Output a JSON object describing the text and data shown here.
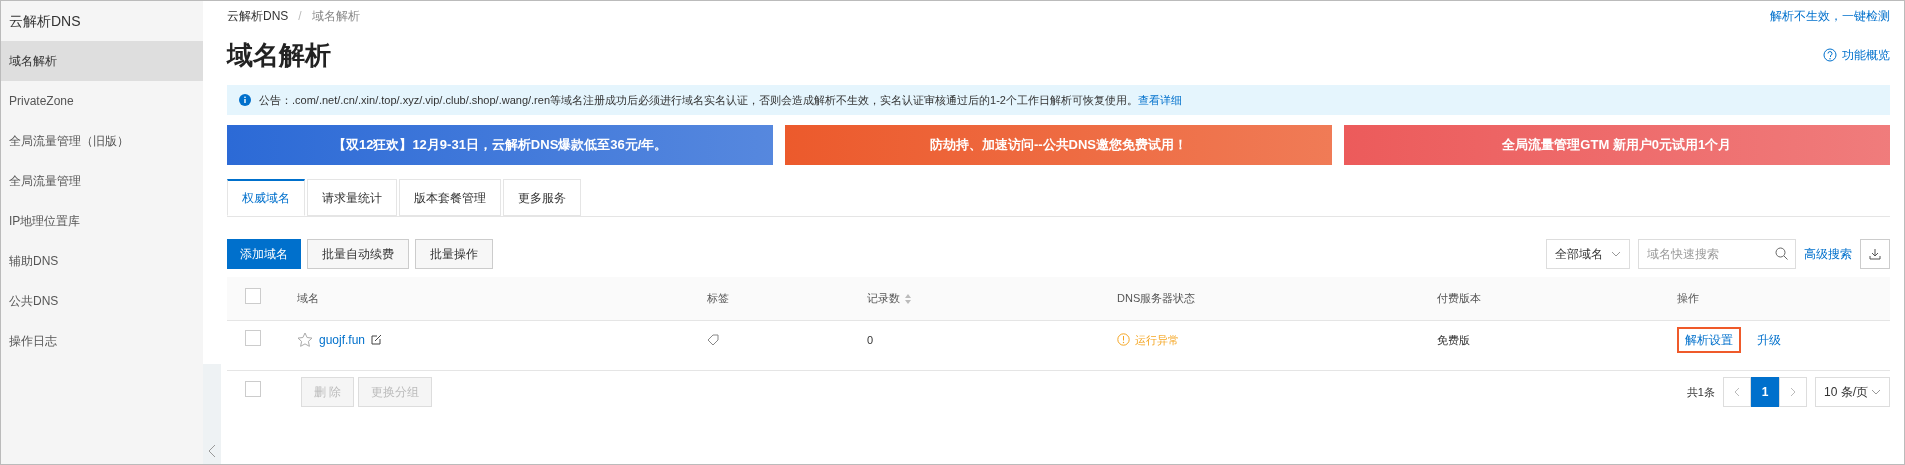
{
  "sidebar": {
    "title": "云解析DNS",
    "items": [
      {
        "label": "域名解析",
        "selected": true
      },
      {
        "label": "PrivateZone",
        "selected": false
      },
      {
        "label": "全局流量管理（旧版）",
        "selected": false
      },
      {
        "label": "全局流量管理",
        "selected": false
      },
      {
        "label": "IP地理位置库",
        "selected": false
      },
      {
        "label": "辅助DNS",
        "selected": false
      },
      {
        "label": "公共DNS",
        "selected": false
      },
      {
        "label": "操作日志",
        "selected": false
      }
    ]
  },
  "breadcrumb": [
    "云解析DNS",
    "域名解析"
  ],
  "breadcrumb_separator": "/",
  "top_link": "解析不生效，一键检测",
  "page_title": "域名解析",
  "overview_link": "功能概览",
  "notice": {
    "text": "公告：.com/.net/.cn/.xin/.top/.xyz/.vip/.club/.shop/.wang/.ren等域名注册成功后必须进行域名实名认证，否则会造成解析不生效，实名认证审核通过后的1-2个工作日解析可恢复使用。",
    "link": "查看详细"
  },
  "banners": [
    {
      "text": "【双12狂欢】12月9-31日，云解析DNS爆款低至36元/年。",
      "color": "#2c6ad6"
    },
    {
      "text": "防劫持、加速访问--公共DNS邀您免费试用！",
      "color": "#ec5a2c"
    },
    {
      "text": "全局流量管理GTM 新用户0元试用1个月",
      "color": "#ec5b5b"
    }
  ],
  "tabs": [
    {
      "label": "权威域名",
      "selected": true
    },
    {
      "label": "请求量统计",
      "selected": false
    },
    {
      "label": "版本套餐管理",
      "selected": false
    },
    {
      "label": "更多服务",
      "selected": false
    }
  ],
  "toolbar": {
    "primary": "添加域名",
    "buttons": [
      "批量自动续费",
      "批量操作"
    ],
    "filter": "全部域名",
    "search_placeholder": "域名快速搜索",
    "advanced": "高级搜索"
  },
  "table": {
    "select_all": false,
    "columns": [
      "域名",
      "标签",
      "记录数",
      "DNS服务器状态",
      "付费版本",
      "操作"
    ],
    "rows": [
      {
        "checked": false,
        "starred": false,
        "domain": "guojf.fun",
        "records": "0",
        "status": "运行异常",
        "plan": "免费版",
        "actions": [
          {
            "label": "解析设置",
            "highlighted": true
          },
          {
            "label": "升级",
            "highlighted": false
          }
        ]
      }
    ]
  },
  "footer": {
    "checked": false,
    "buttons": [
      "删 除",
      "更换分组"
    ],
    "total": "共1条",
    "page": "1",
    "page_size": "10 条/页"
  }
}
